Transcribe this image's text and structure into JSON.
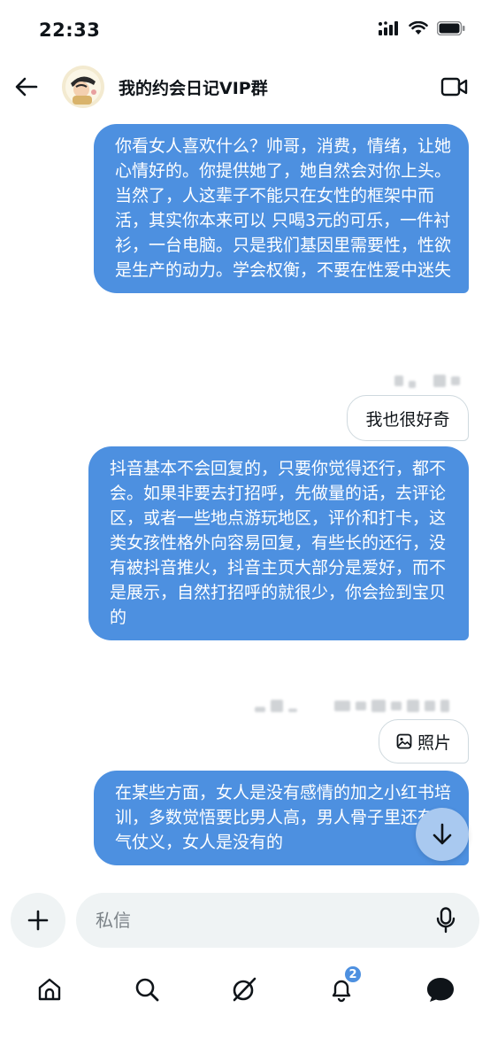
{
  "status_bar": {
    "time": "22:33"
  },
  "header": {
    "title": "我的约会日记VIP群",
    "back_icon": "arrow-left-icon",
    "video_icon": "video-call-icon"
  },
  "messages": [
    {
      "type": "sent",
      "text": "你看女人喜欢什么？帅哥，消费，情绪，让她心情好的。你提供她了，她自然会对你上头。当然了，人这辈子不能只在女性的框架中而活，其实你本来可以 只喝3元的可乐，一件衬衫，一台电脑。只是我们基因里需要性，性欲是生产的动力。学会权衡，不要在性爱中迷失"
    },
    {
      "type": "received",
      "text": "我也很好奇"
    },
    {
      "type": "sent",
      "text": "抖音基本不会回复的，只要你觉得还行，都不会。如果非要去打招呼，先做量的话，去评论区，或者一些地点游玩地区，评价和打卡，这类女孩性格外向容易回复，有些长的还行，没有被抖音推火，抖音主页大部分是爱好，而不是展示，自然打招呼的就很少，你会捡到宝贝的"
    },
    {
      "type": "received",
      "text": "照片",
      "icon": "image-icon"
    },
    {
      "type": "sent",
      "text": "在某些方面，女人是没有感情的加之小红书培训，多数觉悟要比男人高，男人骨子里还有义气仗义，女人是没有的"
    }
  ],
  "compose": {
    "placeholder": "私信"
  },
  "tabbar": {
    "items": [
      "home-icon",
      "search-icon",
      "grok-icon",
      "notifications-icon",
      "messages-icon"
    ],
    "notification_count": "2"
  },
  "colors": {
    "accent": "#4d90e0",
    "bubble_border": "#cfd9de",
    "input_bg": "#eff3f4"
  }
}
